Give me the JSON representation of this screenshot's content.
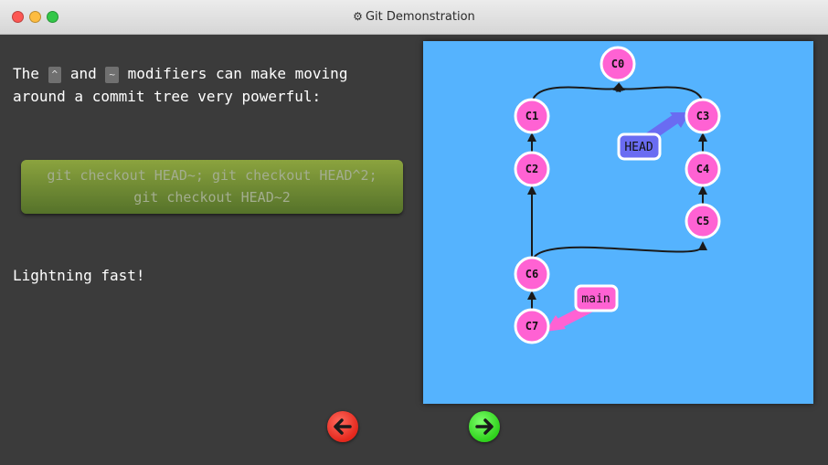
{
  "window": {
    "title": "Git Demonstration",
    "title_icon": "gear-icon"
  },
  "lesson": {
    "intro_before": "The",
    "key_caret": "^",
    "intro_and": "and",
    "key_tilde": "~",
    "intro_after": "modifiers can make moving around a commit tree very powerful:",
    "command_line1": "git checkout HEAD~; git checkout HEAD^2;",
    "command_line2": "git checkout HEAD~2",
    "closing": "Lightning fast!"
  },
  "graph": {
    "background": "#55b3fe",
    "commits": [
      {
        "id": "C0",
        "label": "C0"
      },
      {
        "id": "C1",
        "label": "C1"
      },
      {
        "id": "C2",
        "label": "C2"
      },
      {
        "id": "C3",
        "label": "C3"
      },
      {
        "id": "C4",
        "label": "C4"
      },
      {
        "id": "C5",
        "label": "C5"
      },
      {
        "id": "C6",
        "label": "C6"
      },
      {
        "id": "C7",
        "label": "C7"
      }
    ],
    "refs": [
      {
        "name": "HEAD",
        "label": "HEAD",
        "target": "C3"
      },
      {
        "name": "main",
        "label": "main",
        "target": "C7"
      }
    ],
    "colors": {
      "commit_fill": "#ff62d3",
      "head_fill": "#6a6cf2",
      "branch_fill": "#ff62d3"
    }
  },
  "navigation": {
    "back_icon": "arrow-left-icon",
    "forward_icon": "arrow-right-icon",
    "back_color": "#e4271c",
    "forward_color": "#2fd21c"
  }
}
